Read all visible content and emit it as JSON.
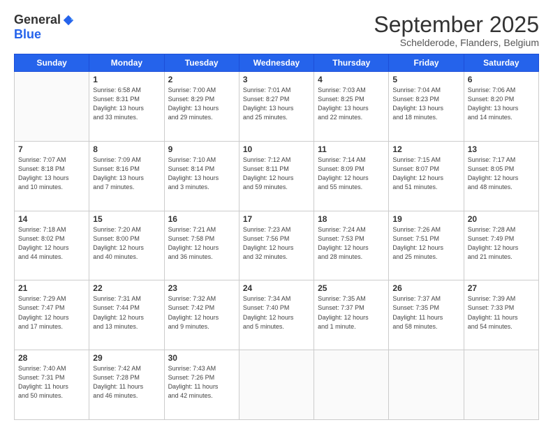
{
  "header": {
    "logo_general": "General",
    "logo_blue": "Blue",
    "month_title": "September 2025",
    "subtitle": "Schelderode, Flanders, Belgium"
  },
  "days_of_week": [
    "Sunday",
    "Monday",
    "Tuesday",
    "Wednesday",
    "Thursday",
    "Friday",
    "Saturday"
  ],
  "weeks": [
    [
      {
        "day": "",
        "info": ""
      },
      {
        "day": "1",
        "info": "Sunrise: 6:58 AM\nSunset: 8:31 PM\nDaylight: 13 hours\nand 33 minutes."
      },
      {
        "day": "2",
        "info": "Sunrise: 7:00 AM\nSunset: 8:29 PM\nDaylight: 13 hours\nand 29 minutes."
      },
      {
        "day": "3",
        "info": "Sunrise: 7:01 AM\nSunset: 8:27 PM\nDaylight: 13 hours\nand 25 minutes."
      },
      {
        "day": "4",
        "info": "Sunrise: 7:03 AM\nSunset: 8:25 PM\nDaylight: 13 hours\nand 22 minutes."
      },
      {
        "day": "5",
        "info": "Sunrise: 7:04 AM\nSunset: 8:23 PM\nDaylight: 13 hours\nand 18 minutes."
      },
      {
        "day": "6",
        "info": "Sunrise: 7:06 AM\nSunset: 8:20 PM\nDaylight: 13 hours\nand 14 minutes."
      }
    ],
    [
      {
        "day": "7",
        "info": "Sunrise: 7:07 AM\nSunset: 8:18 PM\nDaylight: 13 hours\nand 10 minutes."
      },
      {
        "day": "8",
        "info": "Sunrise: 7:09 AM\nSunset: 8:16 PM\nDaylight: 13 hours\nand 7 minutes."
      },
      {
        "day": "9",
        "info": "Sunrise: 7:10 AM\nSunset: 8:14 PM\nDaylight: 13 hours\nand 3 minutes."
      },
      {
        "day": "10",
        "info": "Sunrise: 7:12 AM\nSunset: 8:11 PM\nDaylight: 12 hours\nand 59 minutes."
      },
      {
        "day": "11",
        "info": "Sunrise: 7:14 AM\nSunset: 8:09 PM\nDaylight: 12 hours\nand 55 minutes."
      },
      {
        "day": "12",
        "info": "Sunrise: 7:15 AM\nSunset: 8:07 PM\nDaylight: 12 hours\nand 51 minutes."
      },
      {
        "day": "13",
        "info": "Sunrise: 7:17 AM\nSunset: 8:05 PM\nDaylight: 12 hours\nand 48 minutes."
      }
    ],
    [
      {
        "day": "14",
        "info": "Sunrise: 7:18 AM\nSunset: 8:02 PM\nDaylight: 12 hours\nand 44 minutes."
      },
      {
        "day": "15",
        "info": "Sunrise: 7:20 AM\nSunset: 8:00 PM\nDaylight: 12 hours\nand 40 minutes."
      },
      {
        "day": "16",
        "info": "Sunrise: 7:21 AM\nSunset: 7:58 PM\nDaylight: 12 hours\nand 36 minutes."
      },
      {
        "day": "17",
        "info": "Sunrise: 7:23 AM\nSunset: 7:56 PM\nDaylight: 12 hours\nand 32 minutes."
      },
      {
        "day": "18",
        "info": "Sunrise: 7:24 AM\nSunset: 7:53 PM\nDaylight: 12 hours\nand 28 minutes."
      },
      {
        "day": "19",
        "info": "Sunrise: 7:26 AM\nSunset: 7:51 PM\nDaylight: 12 hours\nand 25 minutes."
      },
      {
        "day": "20",
        "info": "Sunrise: 7:28 AM\nSunset: 7:49 PM\nDaylight: 12 hours\nand 21 minutes."
      }
    ],
    [
      {
        "day": "21",
        "info": "Sunrise: 7:29 AM\nSunset: 7:47 PM\nDaylight: 12 hours\nand 17 minutes."
      },
      {
        "day": "22",
        "info": "Sunrise: 7:31 AM\nSunset: 7:44 PM\nDaylight: 12 hours\nand 13 minutes."
      },
      {
        "day": "23",
        "info": "Sunrise: 7:32 AM\nSunset: 7:42 PM\nDaylight: 12 hours\nand 9 minutes."
      },
      {
        "day": "24",
        "info": "Sunrise: 7:34 AM\nSunset: 7:40 PM\nDaylight: 12 hours\nand 5 minutes."
      },
      {
        "day": "25",
        "info": "Sunrise: 7:35 AM\nSunset: 7:37 PM\nDaylight: 12 hours\nand 1 minute."
      },
      {
        "day": "26",
        "info": "Sunrise: 7:37 AM\nSunset: 7:35 PM\nDaylight: 11 hours\nand 58 minutes."
      },
      {
        "day": "27",
        "info": "Sunrise: 7:39 AM\nSunset: 7:33 PM\nDaylight: 11 hours\nand 54 minutes."
      }
    ],
    [
      {
        "day": "28",
        "info": "Sunrise: 7:40 AM\nSunset: 7:31 PM\nDaylight: 11 hours\nand 50 minutes."
      },
      {
        "day": "29",
        "info": "Sunrise: 7:42 AM\nSunset: 7:28 PM\nDaylight: 11 hours\nand 46 minutes."
      },
      {
        "day": "30",
        "info": "Sunrise: 7:43 AM\nSunset: 7:26 PM\nDaylight: 11 hours\nand 42 minutes."
      },
      {
        "day": "",
        "info": ""
      },
      {
        "day": "",
        "info": ""
      },
      {
        "day": "",
        "info": ""
      },
      {
        "day": "",
        "info": ""
      }
    ]
  ]
}
